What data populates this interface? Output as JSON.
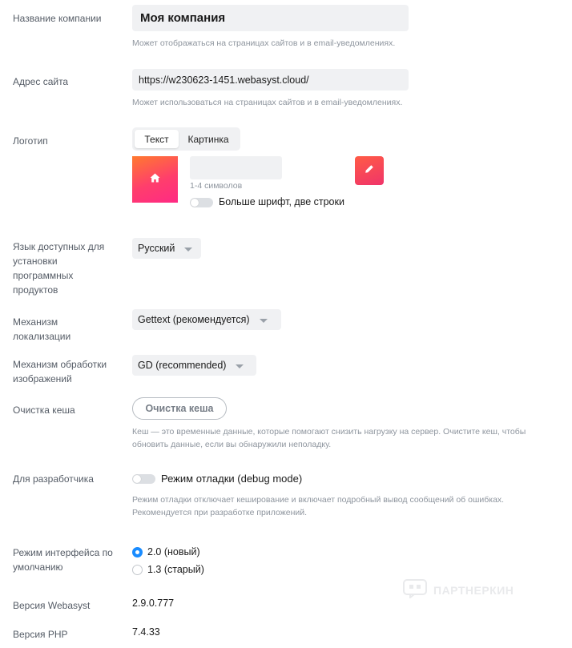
{
  "company_name": {
    "label": "Название компании",
    "value": "Моя компания",
    "hint": "Может отображаться на страницах сайтов и в email-уведомлениях."
  },
  "site_address": {
    "label": "Адрес сайта",
    "value": "https://w230623-1451.webasyst.cloud/",
    "hint": "Может использоваться на страницах сайтов и в email-уведомлениях."
  },
  "logo": {
    "label": "Логотип",
    "tabs": [
      "Текст",
      "Картинка"
    ],
    "active_tab": "Текст",
    "text_value": "",
    "text_hint": "1-4 символов",
    "big_font_toggle_label": "Больше шрифт, две строки",
    "big_font_toggle_on": false,
    "preview_icon": "home-icon",
    "color_picker_icon": "pencil-icon"
  },
  "language": {
    "label": "Язык доступных для установки программных продуктов",
    "selected": "Русский"
  },
  "localization": {
    "label": "Механизм локализации",
    "selected": "Gettext (рекомендуется)"
  },
  "image_processing": {
    "label": "Механизм обработки изображений",
    "selected": "GD (recommended)"
  },
  "cache": {
    "label": "Очистка кеша",
    "button": "Очистка кеша",
    "hint": "Кеш — это временные данные, которые помогают снизить нагрузку на сервер. Очистите кеш, чтобы обновить данные, если вы обнаружили неполадку."
  },
  "developer": {
    "label": "Для разработчика",
    "toggle_label": "Режим отладки (debug mode)",
    "toggle_on": false,
    "hint": "Режим отладки отключает кеширование и включает подробный вывод сообщений об ошибках. Рекомендуется при разработке приложений."
  },
  "interface_mode": {
    "label": "Режим интерфейса по умолчанию",
    "options": [
      "2.0 (новый)",
      "1.3 (старый)"
    ],
    "selected": "2.0 (новый)"
  },
  "webasyst_version": {
    "label": "Версия Webasyst",
    "value": "2.9.0.777"
  },
  "php_version": {
    "label": "Версия PHP",
    "value": "7.4.33"
  },
  "watermark": {
    "text": "ПАРТНЕРКИН"
  },
  "colors": {
    "accent": "#1a8cff",
    "logo_gradient_start": "#ff7a2f",
    "logo_gradient_end": "#ff2a84"
  }
}
